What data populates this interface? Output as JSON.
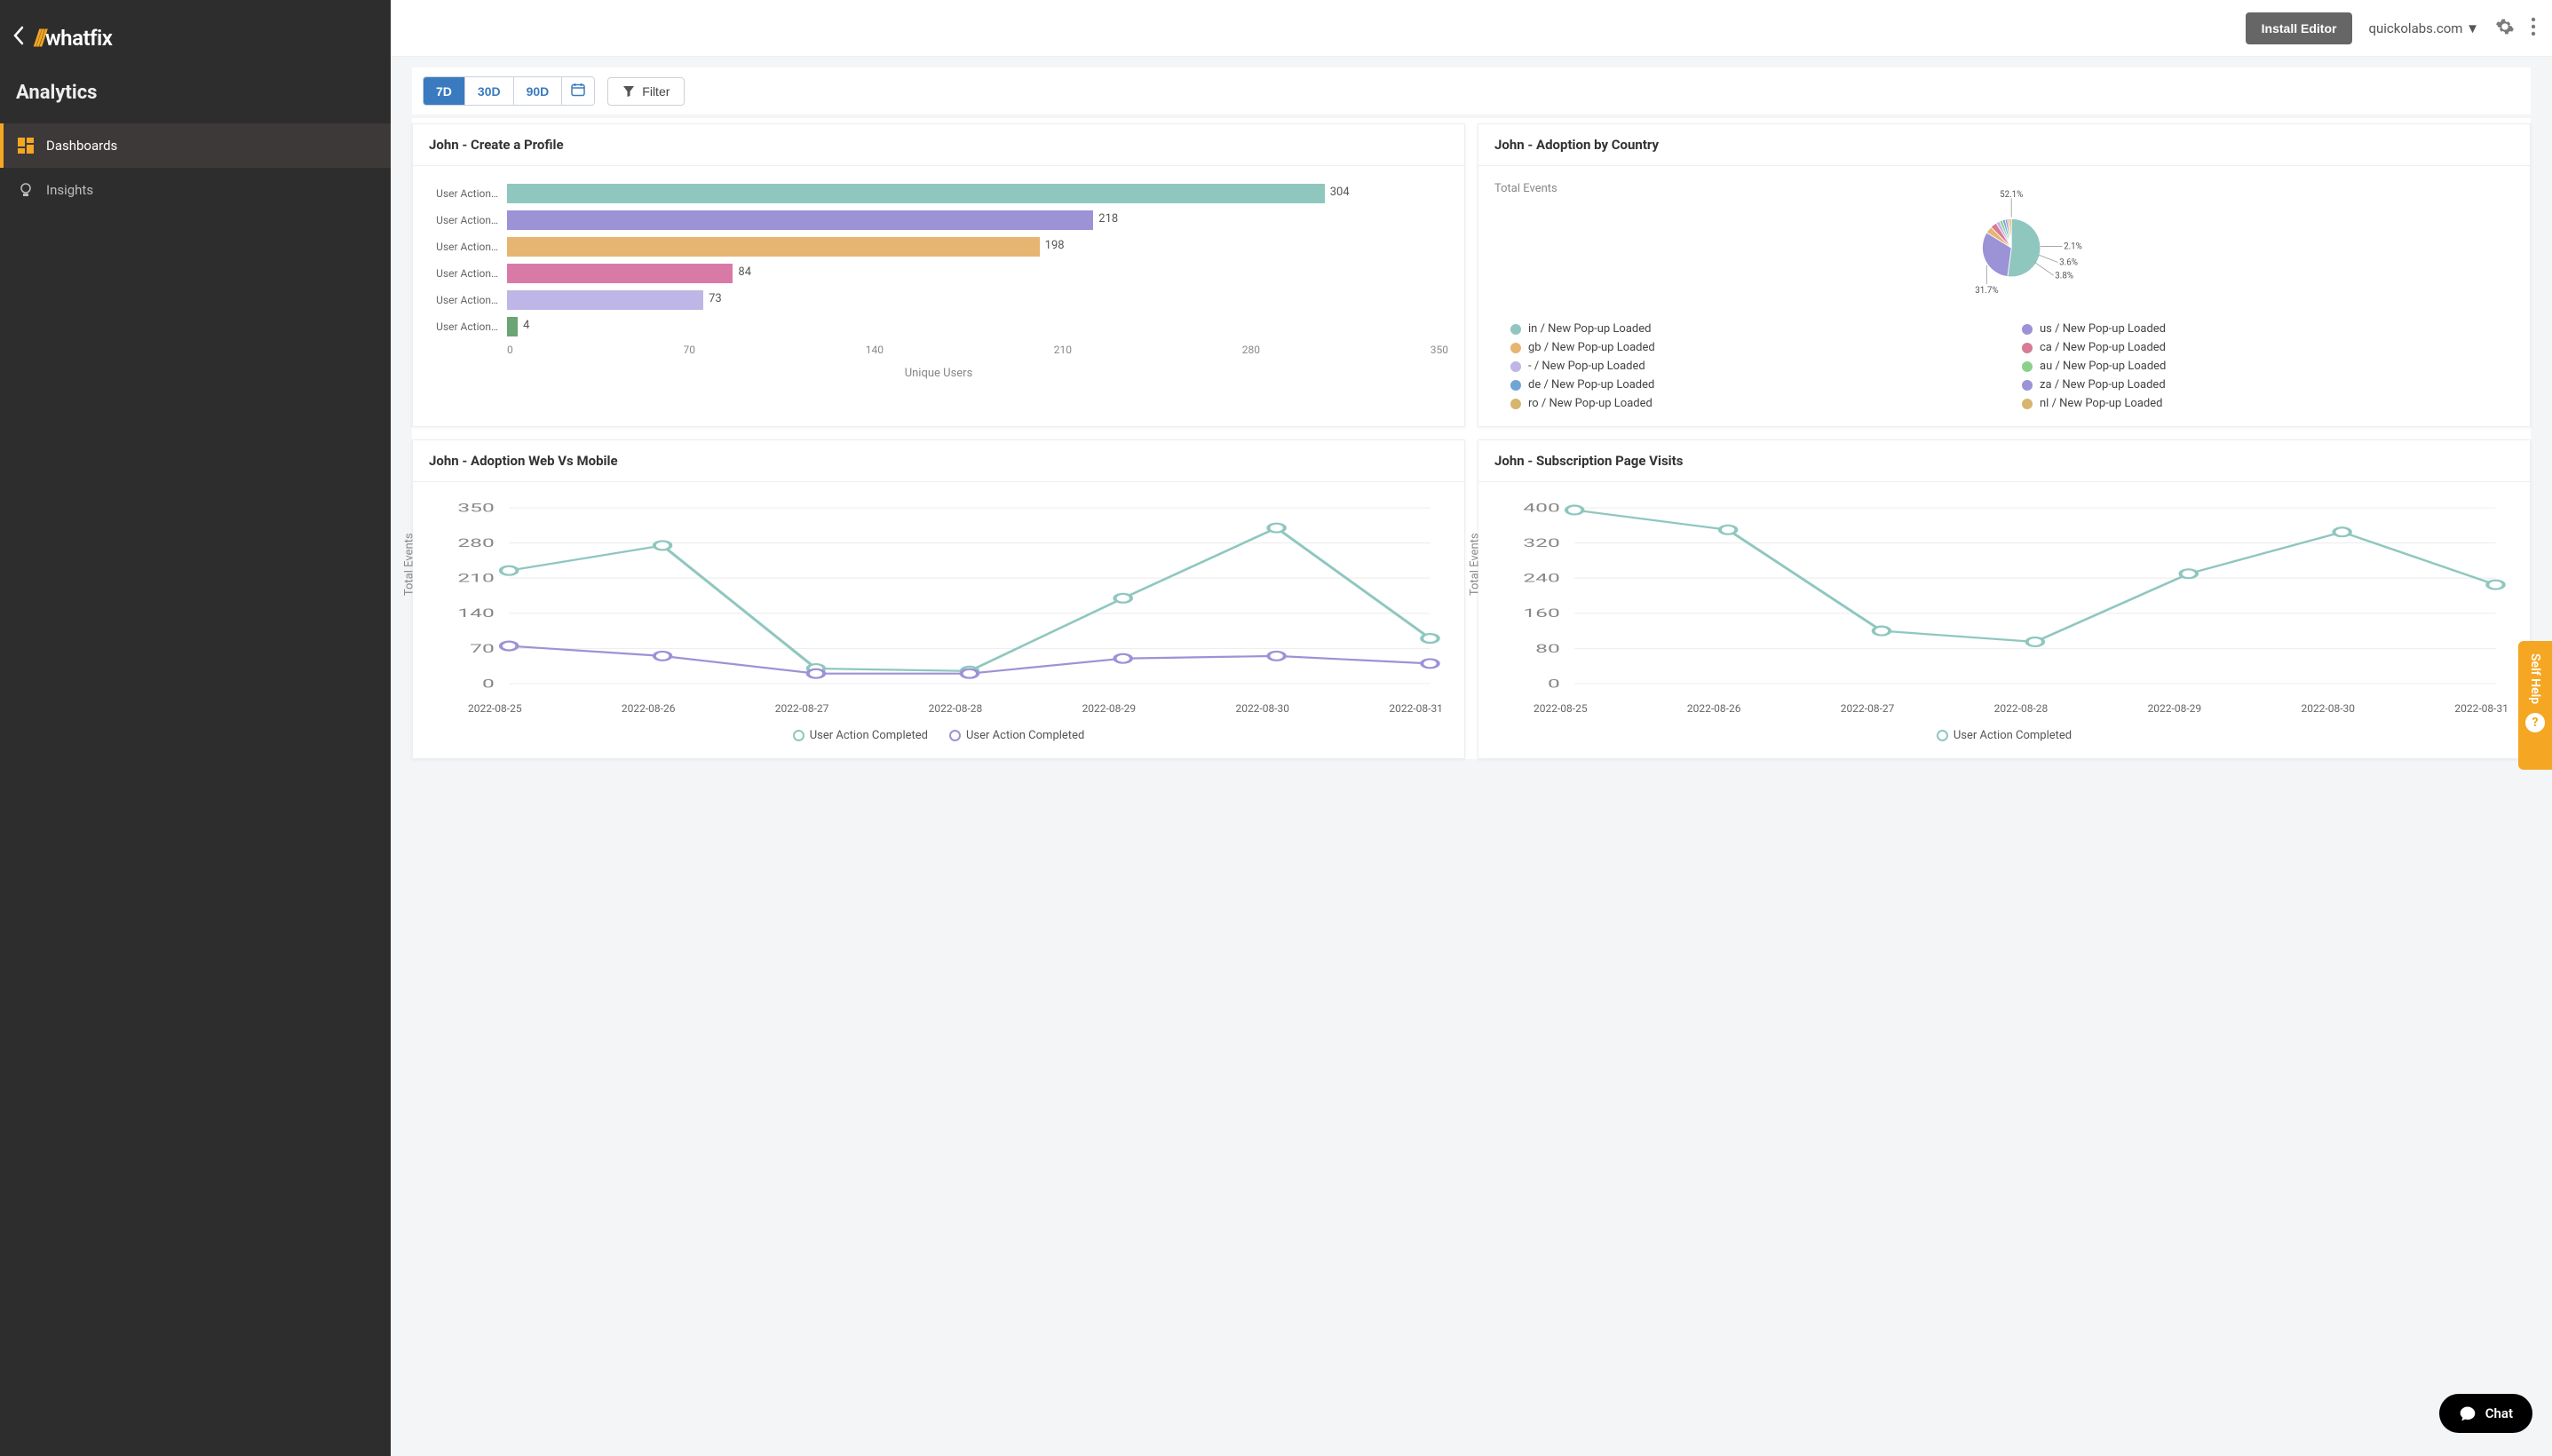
{
  "brand": {
    "name": "whatfix"
  },
  "sidebar": {
    "title": "Analytics",
    "items": [
      {
        "label": "Dashboards",
        "icon": "dashboards-icon",
        "active": true
      },
      {
        "label": "Insights",
        "icon": "insights-icon",
        "active": false
      }
    ]
  },
  "topbar": {
    "install_label": "Install Editor",
    "account_label": "quickolabs.com"
  },
  "toolbar": {
    "range": [
      "7D",
      "30D",
      "90D"
    ],
    "active_range": "7D",
    "filter_label": "Filter"
  },
  "colors": {
    "teal": "#8fc7bf",
    "purple": "#9b93d6",
    "orange": "#e6b572",
    "pink": "#d97aa6",
    "lavender": "#bdb6e6",
    "green_dark": "#6aa573",
    "green": "#8ad28c",
    "blue": "#6fa6d6",
    "mustard": "#d6b56f",
    "rose": "#d97a96",
    "grey": "#9e9e9e"
  },
  "cards": {
    "create_profile": {
      "title": "John - Create a Profile",
      "x_axis_label": "Unique Users",
      "x_ticks": [
        0,
        70,
        140,
        210,
        280,
        350
      ]
    },
    "adoption_country": {
      "title": "John - Adoption by Country",
      "subhead": "Total Events"
    },
    "adoption_web_mobile": {
      "title": "John - Adoption Web Vs Mobile",
      "y_label": "Total Events"
    },
    "subscription_visits": {
      "title": "John - Subscription Page Visits",
      "y_label": "Total Events"
    }
  },
  "chart_data": [
    {
      "id": "create_profile",
      "type": "bar",
      "xlabel": "Unique Users",
      "xlim": [
        0,
        350
      ],
      "x_ticks": [
        0,
        70,
        140,
        210,
        280,
        350
      ],
      "categories": [
        "User Action…",
        "User Action…",
        "User Action…",
        "User Action…",
        "User Action…",
        "User Action…"
      ],
      "series": [
        {
          "name": "Unique Users",
          "values": [
            304,
            218,
            198,
            84,
            73,
            4
          ],
          "colors": [
            "teal",
            "purple",
            "orange",
            "pink",
            "lavender",
            "green_dark"
          ]
        }
      ]
    },
    {
      "id": "adoption_country",
      "type": "pie",
      "title": "Total Events",
      "callouts": [
        "52.1%",
        "31.7%",
        "3.8%",
        "3.6%",
        "2.1%"
      ],
      "slices": [
        {
          "label": "in / New Pop-up Loaded",
          "pct": 52.1,
          "color": "teal"
        },
        {
          "label": "us / New Pop-up Loaded",
          "pct": 31.7,
          "color": "purple"
        },
        {
          "label": "gb / New Pop-up Loaded",
          "pct": 3.8,
          "color": "orange"
        },
        {
          "label": "ca / New Pop-up Loaded",
          "pct": 3.6,
          "color": "rose"
        },
        {
          "label": "- / New Pop-up Loaded",
          "pct": 2.1,
          "color": "lavender"
        },
        {
          "label": "au / New Pop-up Loaded",
          "pct": 1.7,
          "color": "green"
        },
        {
          "label": "de / New Pop-up Loaded",
          "pct": 1.5,
          "color": "blue"
        },
        {
          "label": "za / New Pop-up Loaded",
          "pct": 1.3,
          "color": "purple"
        },
        {
          "label": "ro / New Pop-up Loaded",
          "pct": 1.1,
          "color": "mustard"
        },
        {
          "label": "nl / New Pop-up Loaded",
          "pct": 1.1,
          "color": "mustard"
        }
      ]
    },
    {
      "id": "adoption_web_mobile",
      "type": "line",
      "ylabel": "Total Events",
      "ylim": [
        0,
        350
      ],
      "y_ticks": [
        0,
        70,
        140,
        210,
        280,
        350
      ],
      "x": [
        "2022-08-25",
        "2022-08-26",
        "2022-08-27",
        "2022-08-28",
        "2022-08-29",
        "2022-08-30",
        "2022-08-31"
      ],
      "series": [
        {
          "name": "User Action Completed",
          "color": "teal",
          "values": [
            225,
            275,
            30,
            25,
            170,
            310,
            90
          ]
        },
        {
          "name": "User Action Completed",
          "color": "purple",
          "values": [
            75,
            55,
            20,
            20,
            50,
            55,
            40
          ]
        }
      ]
    },
    {
      "id": "subscription_visits",
      "type": "line",
      "ylabel": "Total Events",
      "ylim": [
        0,
        400
      ],
      "y_ticks": [
        0,
        80,
        160,
        240,
        320,
        400
      ],
      "x": [
        "2022-08-25",
        "2022-08-26",
        "2022-08-27",
        "2022-08-28",
        "2022-08-29",
        "2022-08-30",
        "2022-08-31"
      ],
      "series": [
        {
          "name": "User Action Completed",
          "color": "teal",
          "values": [
            395,
            350,
            120,
            95,
            250,
            345,
            225
          ]
        }
      ]
    }
  ],
  "aux": {
    "self_help_label": "Self Help",
    "chat_label": "Chat"
  }
}
